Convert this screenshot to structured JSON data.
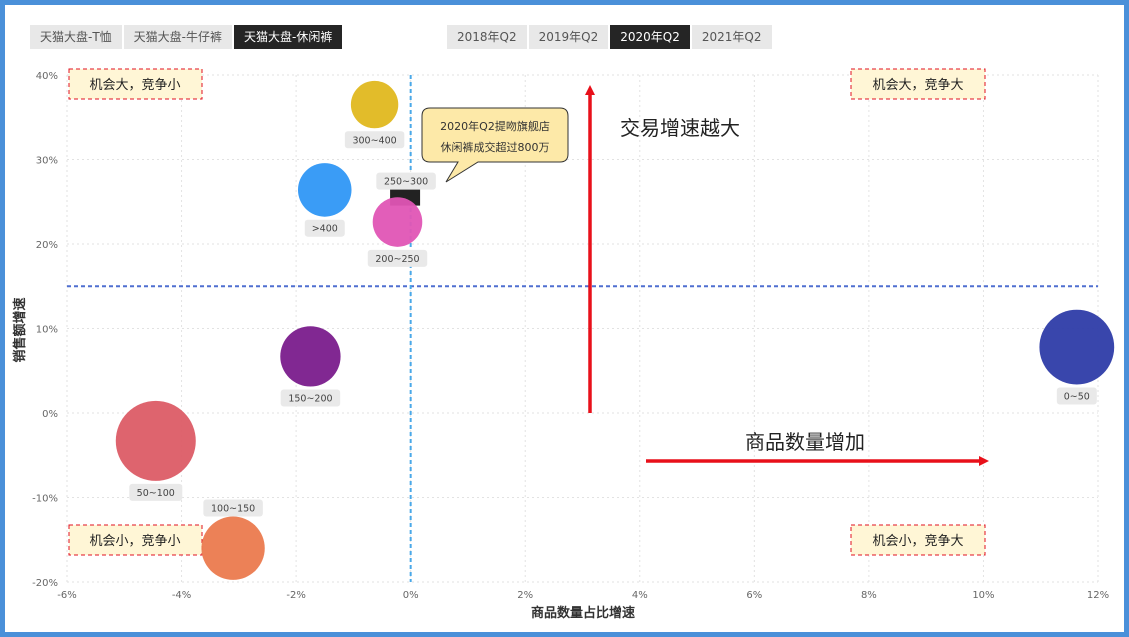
{
  "category_tabs": [
    {
      "label": "天猫大盘-T恤",
      "active": false
    },
    {
      "label": "天猫大盘-牛仔裤",
      "active": false
    },
    {
      "label": "天猫大盘-休闲裤",
      "active": true
    }
  ],
  "period_tabs": [
    {
      "label": "2018年Q2",
      "active": false
    },
    {
      "label": "2019年Q2",
      "active": false
    },
    {
      "label": "2020年Q2",
      "active": true
    },
    {
      "label": "2021年Q2",
      "active": false
    }
  ],
  "quadrants": {
    "top_left": "机会大，竞争小",
    "top_right": "机会大，竞争大",
    "bottom_left": "机会小，竞争小",
    "bottom_right": "机会小，竞争大"
  },
  "annotations": {
    "vertical_arrow": "交易增速越大",
    "horizontal_arrow": "商品数量增加",
    "callout_line1": "2020年Q2提吻旗舰店",
    "callout_line2": "休闲裤成交超过800万"
  },
  "colors": {
    "accent_red": "#e8101a",
    "ref_line": "#4f6fd0",
    "v_ref_line": "#4aa8e8"
  },
  "chart_data": {
    "type": "scatter",
    "xlabel": "商品数量占比增速",
    "ylabel": "销售额增速",
    "xlim": [
      -0.06,
      0.12
    ],
    "ylim": [
      -0.2,
      0.4
    ],
    "x_ticks": [
      "-6%",
      "-4%",
      "-2%",
      "0%",
      "2%",
      "4%",
      "6%",
      "8%",
      "10%",
      "12%"
    ],
    "y_ticks": [
      "40%",
      "30%",
      "20%",
      "10%",
      "0%",
      "-10%",
      "-20%"
    ],
    "ref_x": 0,
    "ref_y": 0.15,
    "grid": true,
    "points": [
      {
        "label": "300~400",
        "x": -0.0063,
        "y": 0.365,
        "size": 0.3,
        "color": "#e0b81f"
      },
      {
        "label": ">400",
        "x": -0.015,
        "y": 0.264,
        "size": 0.45,
        "color": "#2f97f5"
      },
      {
        "label": "250~300",
        "x": -0.0008,
        "y": 0.262,
        "size": 0.4,
        "color": "#222222",
        "shape": "square"
      },
      {
        "label": "200~250",
        "x": -0.0023,
        "y": 0.226,
        "size": 0.35,
        "color": "#e055b5"
      },
      {
        "label": "150~200",
        "x": -0.0175,
        "y": 0.067,
        "size": 0.65,
        "color": "#7a1c8c"
      },
      {
        "label": "0~50",
        "x": 0.1163,
        "y": 0.078,
        "size": 1.2,
        "color": "#2e3ca8"
      },
      {
        "label": "50~100",
        "x": -0.0445,
        "y": -0.033,
        "size": 1.8,
        "color": "#dc5c66"
      },
      {
        "label": "100~150",
        "x": -0.031,
        "y": -0.16,
        "size": 0.75,
        "color": "#eb7a4e"
      }
    ]
  }
}
